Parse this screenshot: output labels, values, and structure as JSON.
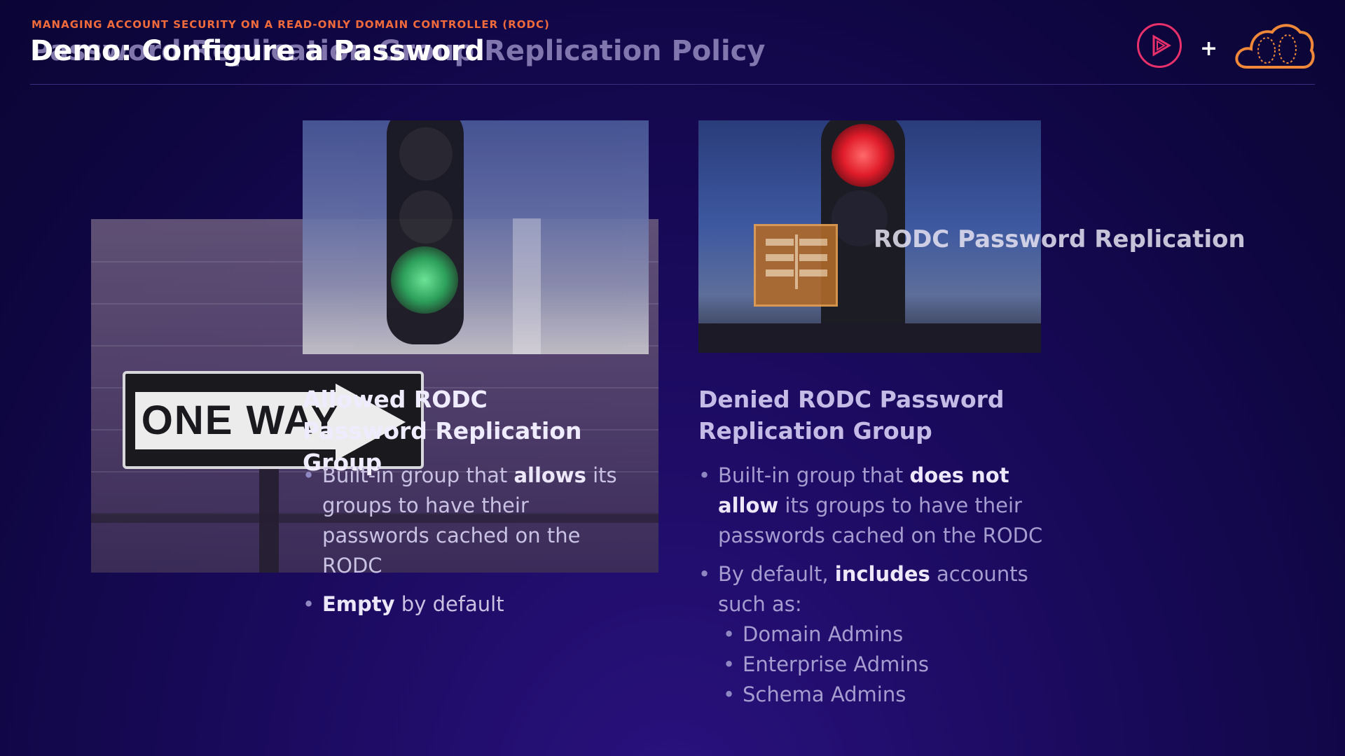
{
  "header": {
    "eyebrow": "MANAGING ACCOUNT SECURITY ON A READ-ONLY DOMAIN CONTROLLER (RODC)",
    "title_main": "Demo: Configure a Password",
    "title_ghost": "Password Replication Group Replication Policy"
  },
  "logos": {
    "play_icon": "play-circle-icon",
    "plus": "+",
    "cloud_icon": "cloud-icon"
  },
  "photos": {
    "sign_text": "ONE WAY"
  },
  "right_panel": {
    "title": "RODC Password Replication",
    "icon": "book-icon"
  },
  "allowed": {
    "heading": "Allowed RODC Password Replication Group",
    "b1_pre": "Built-in group that ",
    "b1_bold": "allows",
    "b1_post": " its groups to have their passwords cached on the RODC",
    "b2_bold": "Empty",
    "b2_post": " by default"
  },
  "denied": {
    "heading": "Denied RODC Password Replication Group",
    "b1_pre": "Built-in group that ",
    "b1_bold": "does not allow",
    "b1_post": " its groups to have their passwords cached on the RODC",
    "b2_pre": "By default, ",
    "b2_bold": "includes",
    "b2_post": " accounts such as:",
    "sub_items": [
      "Domain Admins",
      "Enterprise Admins",
      "Schema Admins"
    ]
  },
  "colors": {
    "accent_orange": "#f06a3c",
    "accent_pink": "#e8306a",
    "background": "#1a0a5c"
  }
}
